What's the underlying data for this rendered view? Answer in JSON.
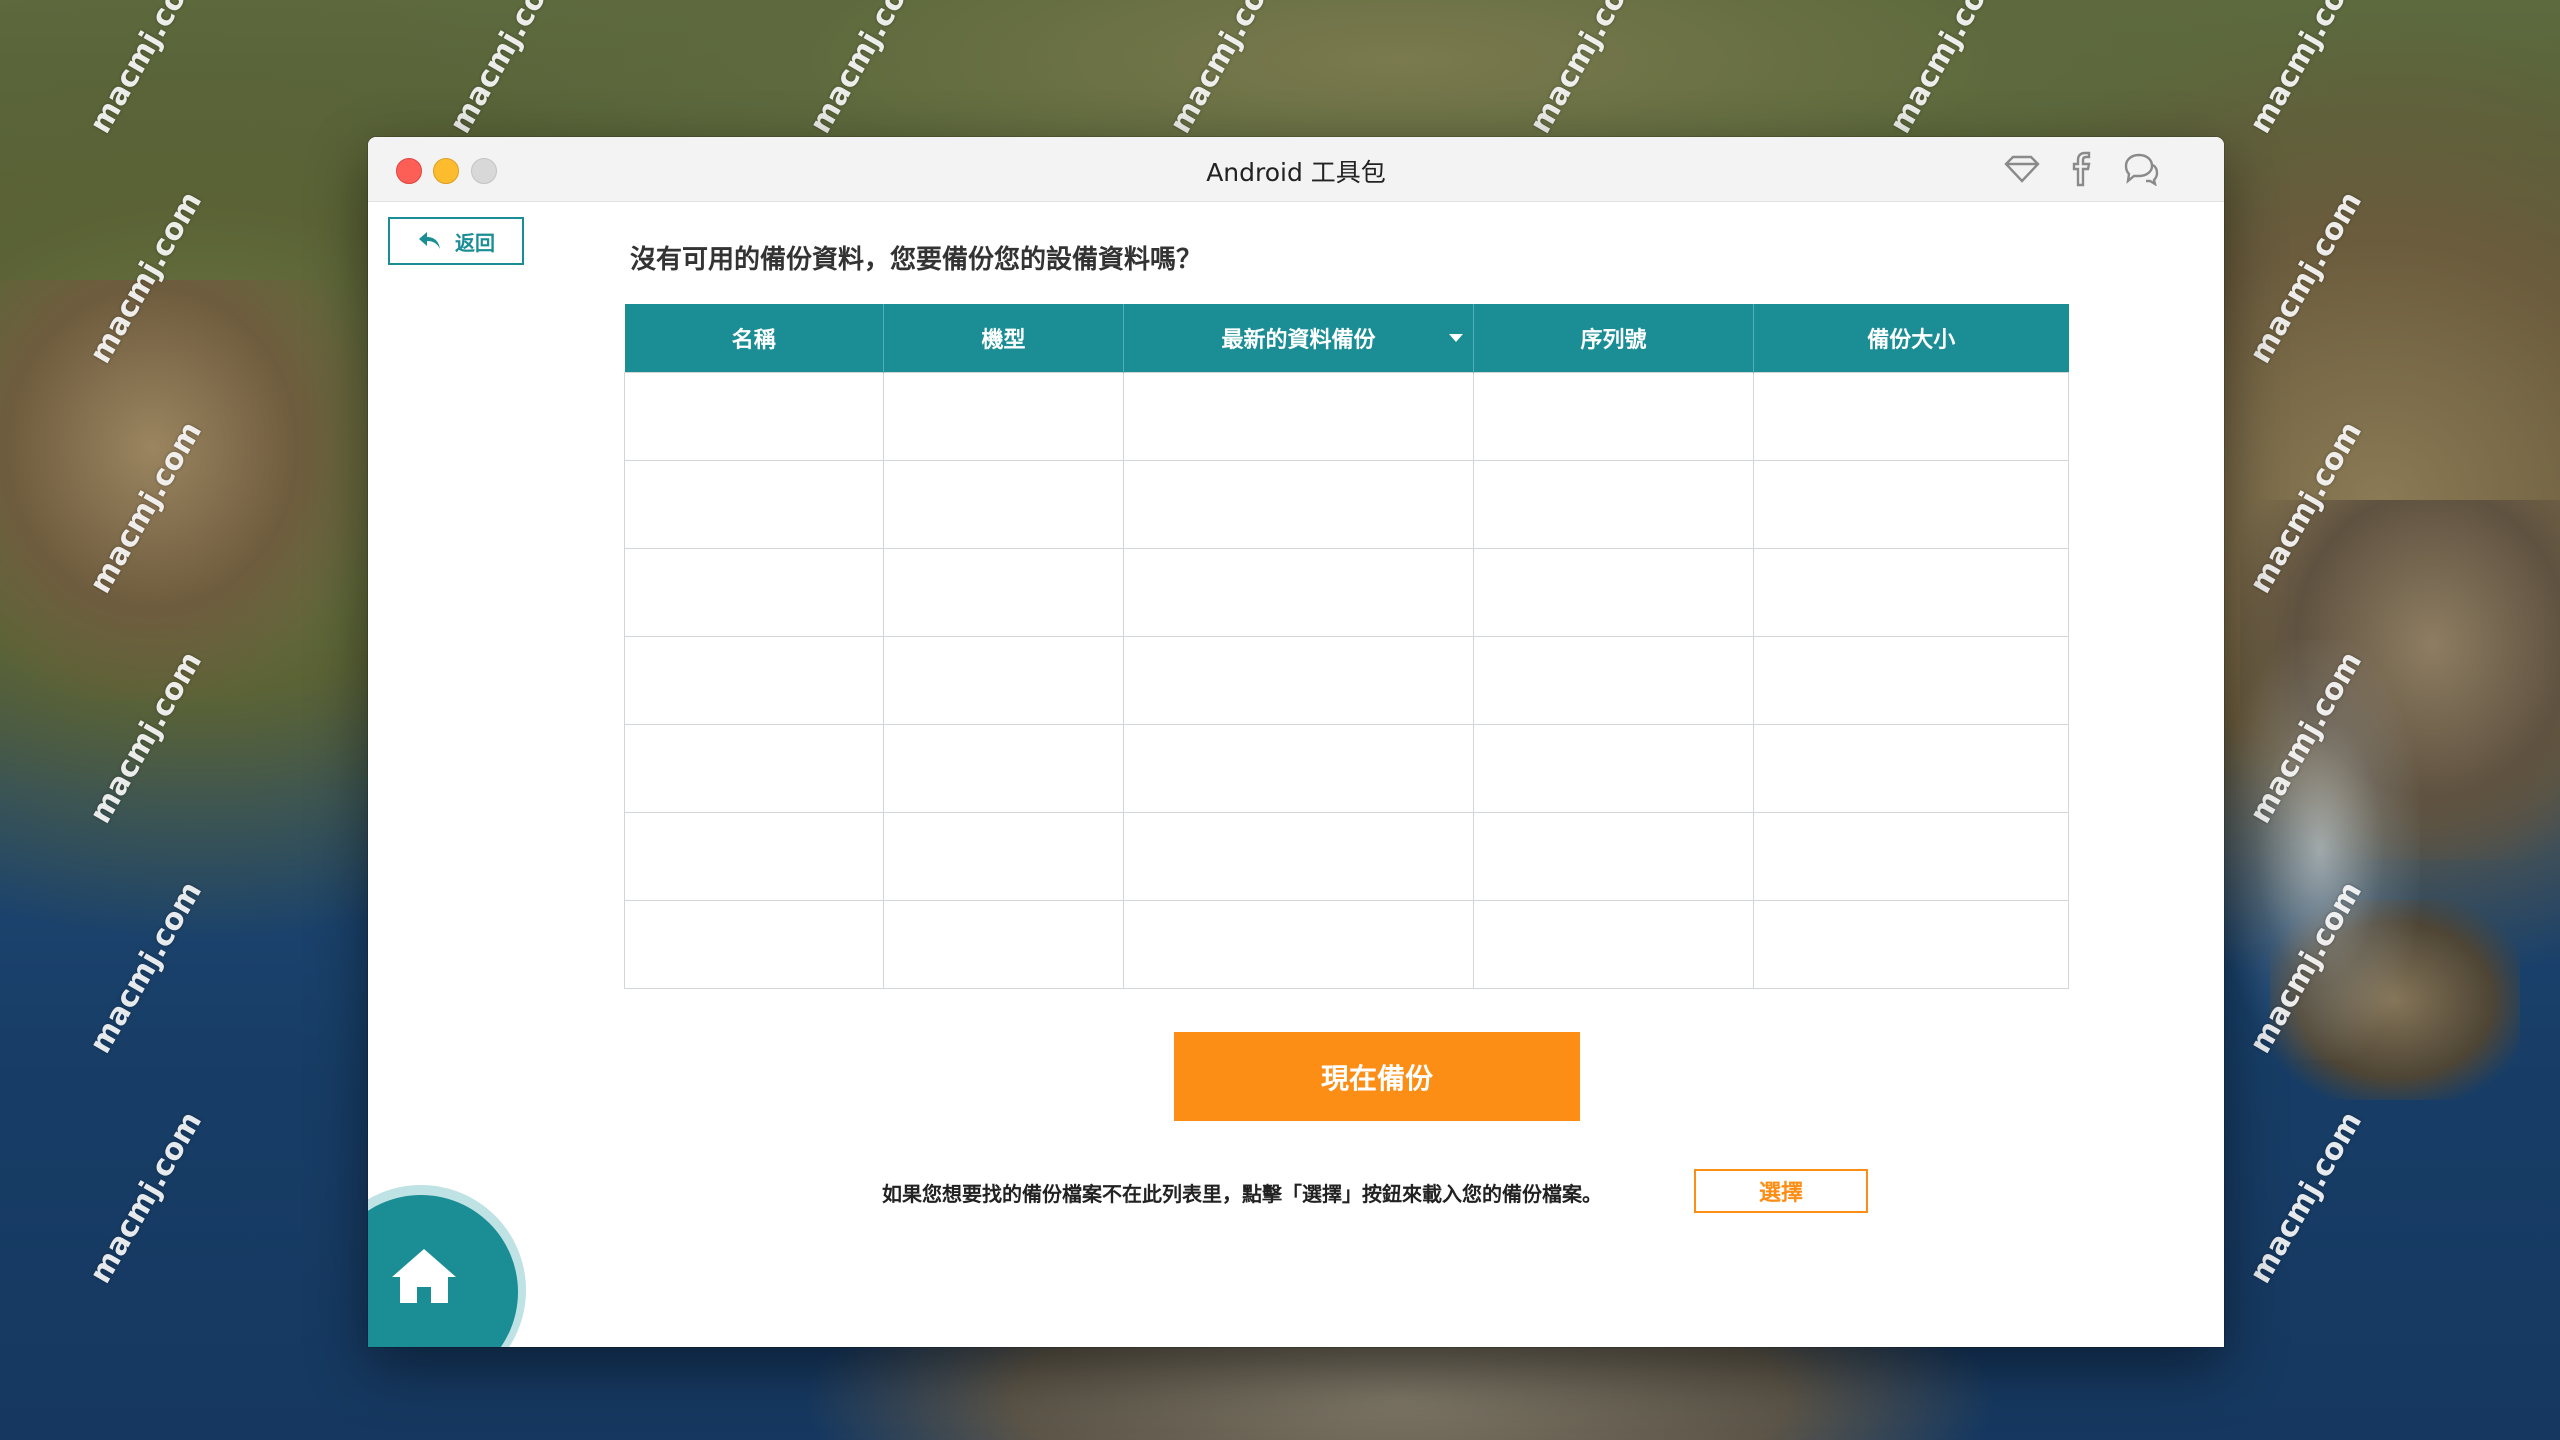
{
  "window": {
    "title": "Android 工具包"
  },
  "toolbar": {
    "icons": [
      "diamond-icon",
      "facebook-icon",
      "chat-icon"
    ]
  },
  "back_button": {
    "label": "返回"
  },
  "prompt": "沒有可用的備份資料，您要備份您的設備資料嗎？",
  "table": {
    "columns": [
      "名稱",
      "機型",
      "最新的資料備份",
      "序列號",
      "備份大小"
    ],
    "sorted_column": "最新的資料備份",
    "rows": [
      [
        "",
        "",
        "",
        "",
        ""
      ],
      [
        "",
        "",
        "",
        "",
        ""
      ],
      [
        "",
        "",
        "",
        "",
        ""
      ],
      [
        "",
        "",
        "",
        "",
        ""
      ],
      [
        "",
        "",
        "",
        "",
        ""
      ],
      [
        "",
        "",
        "",
        "",
        ""
      ],
      [
        "",
        "",
        "",
        "",
        ""
      ]
    ]
  },
  "backup_button": {
    "label": "現在備份"
  },
  "hint": {
    "text": "如果您想要找的備份檔案不在此列表里，點擊「選擇」按鈕來載入您的備份檔案。",
    "select_label": "選擇"
  },
  "watermark": "macmj.com",
  "colors": {
    "accent_teal": "#1a8d95",
    "accent_orange": "#fc8e15",
    "close": "#fd5f57",
    "minimize": "#fdbc2e"
  }
}
